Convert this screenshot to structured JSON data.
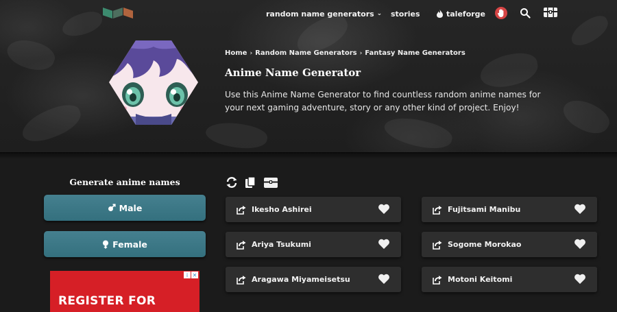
{
  "nav": {
    "generators_label": "random name generators",
    "stories_label": "stories",
    "taleforge_label": "taleforge"
  },
  "breadcrumb": [
    "Home",
    "Random Name Generators",
    "Fantasy Name Generators"
  ],
  "page": {
    "title": "Anime Name Generator",
    "intro": "Use this Anime Name Generator to find countless random anime names for your next gaming adventure, story or any other kind of project. Enjoy!"
  },
  "generator": {
    "heading": "Generate anime names",
    "male_label": "Male",
    "female_label": "Female"
  },
  "ad": {
    "text": "REGISTER FOR"
  },
  "names": {
    "left": [
      "Ikesho Ashirei",
      "Ariya Tsukumi",
      "Aragawa Miyameisetsu"
    ],
    "right": [
      "Fujitsami Manibu",
      "Sogome Morokao",
      "Motoni Keitomi"
    ]
  },
  "colors": {
    "accent_button": "#3b7886",
    "card_bg": "#2e2e2e",
    "ad_red": "#d61f26",
    "hand_badge": "#d64545"
  },
  "icons": {
    "logo": "book-logo",
    "hand": "hand-icon",
    "search": "search-icon",
    "chest": "treasure-chest-icon",
    "refresh": "refresh-icon",
    "copy": "copy-icon",
    "share": "share-icon",
    "heart": "heart-icon",
    "male": "male-symbol-icon",
    "female": "female-symbol-icon"
  }
}
